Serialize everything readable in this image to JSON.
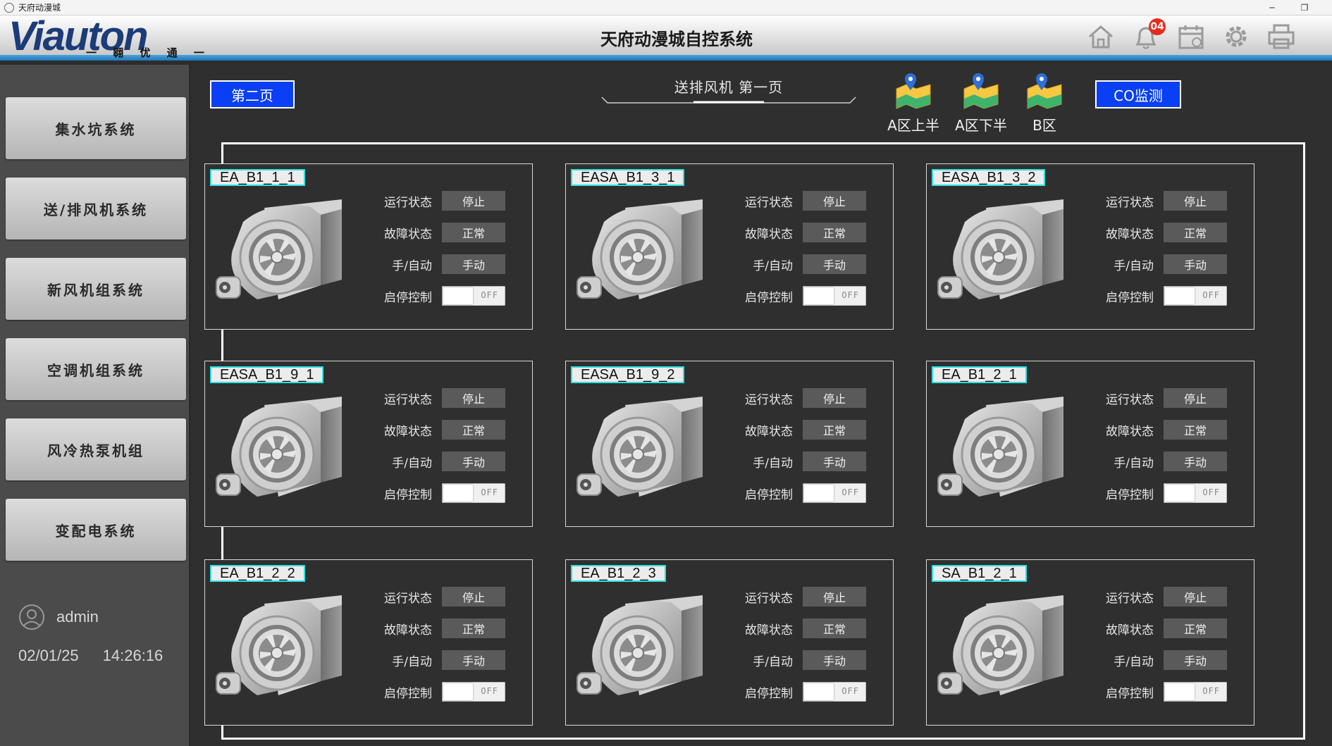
{
  "window": {
    "title": "天府动漫城"
  },
  "header": {
    "logo_text": "Viauton",
    "logo_sub": "一 翱 优 通 一",
    "title": "天府动漫城自控系统",
    "icons": [
      "home-icon",
      "bell-icon",
      "calendar-icon",
      "gear-icon",
      "printer-icon"
    ],
    "notification_count": "04"
  },
  "sidebar": {
    "items": [
      {
        "label": "集水坑系统"
      },
      {
        "label": "送/排风机系统"
      },
      {
        "label": "新风机组系统"
      },
      {
        "label": "空调机组系统"
      },
      {
        "label": "风冷热泵机组"
      },
      {
        "label": "变配电系统"
      }
    ],
    "user": "admin",
    "date": "02/01/25",
    "time": "14:26:16"
  },
  "toolbar": {
    "prev_page_label": "第二页",
    "page_title": "送排风机  第一页",
    "areas": [
      {
        "label": "A区上半"
      },
      {
        "label": "A区下半"
      },
      {
        "label": "B区"
      }
    ],
    "co_label": "CO监测"
  },
  "labels": {
    "run_status": "运行状态",
    "fault_status": "故障状态",
    "mode": "手/自动",
    "control": "启停控制",
    "off": "OFF"
  },
  "colors": {
    "accent_blue": "#0a3ff5",
    "tag_border": "#2de0e0",
    "header_line": "#2076b6",
    "badge": "#e52b1e"
  },
  "devices": [
    {
      "name": "EA_B1_1_1",
      "run": "停止",
      "fault": "正常",
      "mode": "手动",
      "switch": "OFF"
    },
    {
      "name": "EASA_B1_3_1",
      "run": "停止",
      "fault": "正常",
      "mode": "手动",
      "switch": "OFF"
    },
    {
      "name": "EASA_B1_3_2",
      "run": "停止",
      "fault": "正常",
      "mode": "手动",
      "switch": "OFF"
    },
    {
      "name": "EASA_B1_9_1",
      "run": "停止",
      "fault": "正常",
      "mode": "手动",
      "switch": "OFF"
    },
    {
      "name": "EASA_B1_9_2",
      "run": "停止",
      "fault": "正常",
      "mode": "手动",
      "switch": "OFF"
    },
    {
      "name": "EA_B1_2_1",
      "run": "停止",
      "fault": "正常",
      "mode": "手动",
      "switch": "OFF"
    },
    {
      "name": "EA_B1_2_2",
      "run": "停止",
      "fault": "正常",
      "mode": "手动",
      "switch": "OFF"
    },
    {
      "name": "EA_B1_2_3",
      "run": "停止",
      "fault": "正常",
      "mode": "手动",
      "switch": "OFF"
    },
    {
      "name": "SA_B1_2_1",
      "run": "停止",
      "fault": "正常",
      "mode": "手动",
      "switch": "OFF"
    }
  ]
}
